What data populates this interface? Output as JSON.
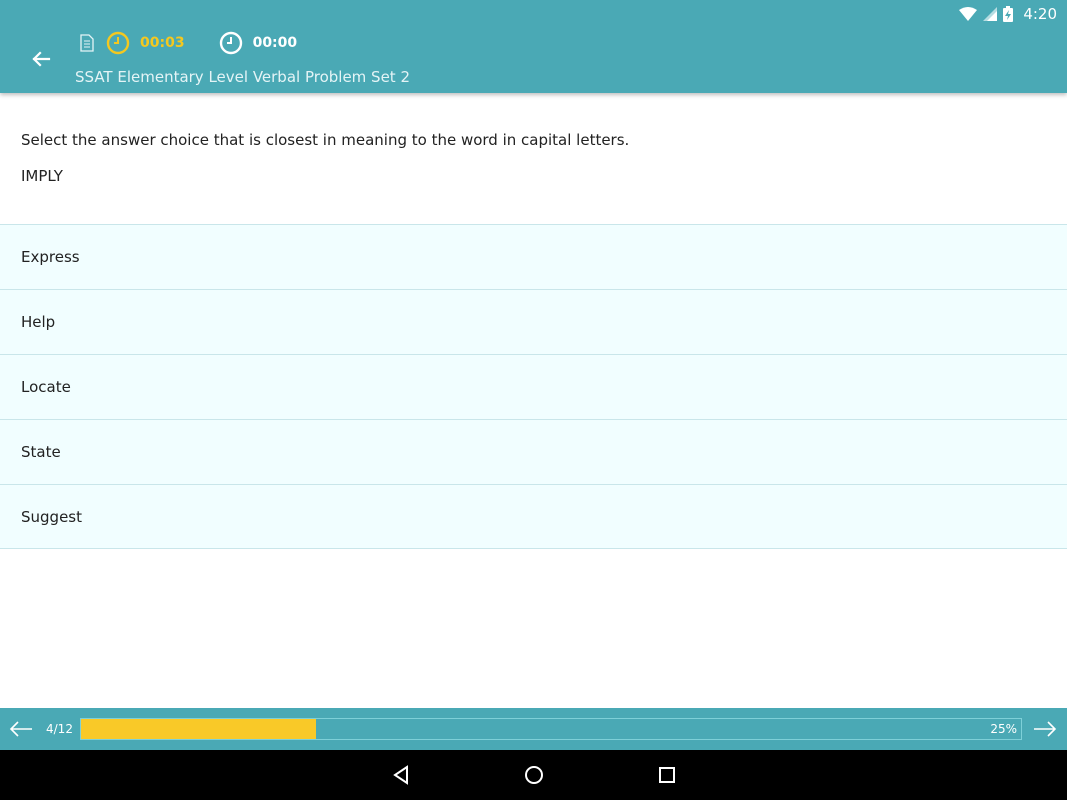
{
  "status_bar": {
    "time": "4:20"
  },
  "header": {
    "title": "SSAT Elementary Level Verbal Problem Set 2",
    "timer_question": "00:03",
    "timer_total": "00:00",
    "colors": {
      "bar": "#4aa9b5",
      "accent": "#f4c81f"
    }
  },
  "question": {
    "prompt": "Select the answer choice that is closest in meaning to the word in capital letters.",
    "word": "IMPLY"
  },
  "choices": [
    "Express",
    "Help",
    "Locate",
    "State",
    "Suggest"
  ],
  "progress": {
    "count": "4/12",
    "percent_label": "25%",
    "fraction": 0.25
  }
}
